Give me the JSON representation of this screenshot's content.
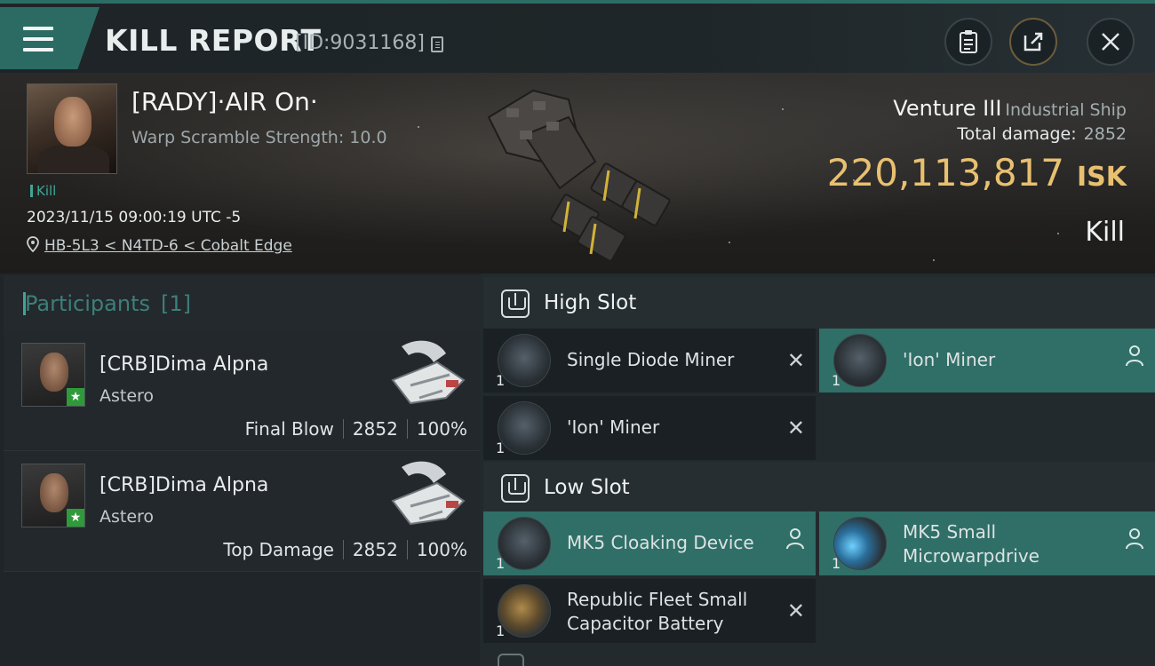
{
  "header": {
    "title": "KILL REPORT",
    "report_id": "[ID:9031168]",
    "buttons": [
      "clipboard",
      "share",
      "close"
    ]
  },
  "victim": {
    "name": "[RADY]·AIR On·",
    "warp_scramble": "Warp Scramble Strength: 10.0",
    "kill_tag": "Kill",
    "datetime": "2023/11/15 09:00:19 UTC -5",
    "location": "HB-5L3 < N4TD-6 < Cobalt Edge",
    "ship_name": "Venture III",
    "ship_class": "Industrial Ship",
    "total_damage_label": "Total damage:",
    "total_damage": "2852",
    "isk_value": "220,113,817",
    "isk_unit": "ISK",
    "result": "Kill"
  },
  "participants": {
    "title": "Participants",
    "count": "[1]",
    "rows": [
      {
        "name": "[CRB]Dima Alpna",
        "ship": "Astero",
        "role": "Final Blow",
        "damage": "2852",
        "percent": "100%"
      },
      {
        "name": "[CRB]Dima Alpna",
        "ship": "Astero",
        "role": "Top Damage",
        "damage": "2852",
        "percent": "100%"
      }
    ]
  },
  "fitting": {
    "high_slot_label": "High Slot",
    "low_slot_label": "Low Slot",
    "high": [
      {
        "name": "Single Diode Miner",
        "qty": "1",
        "status": "destroyed"
      },
      {
        "name": "'Ion' Miner",
        "qty": "1",
        "status": "dropped"
      },
      {
        "name": "'Ion' Miner",
        "qty": "1",
        "status": "destroyed"
      }
    ],
    "low": [
      {
        "name": "MK5 Cloaking Device",
        "qty": "1",
        "status": "dropped"
      },
      {
        "name": "MK5 Small Microwarpdrive",
        "qty": "1",
        "status": "dropped"
      },
      {
        "name": "Republic Fleet Small Capacitor Battery",
        "qty": "1",
        "status": "destroyed"
      }
    ]
  },
  "colors": {
    "accent_teal": "#2f6f67",
    "isk_gold": "#e8c070",
    "kill_green": "#3fa597"
  }
}
